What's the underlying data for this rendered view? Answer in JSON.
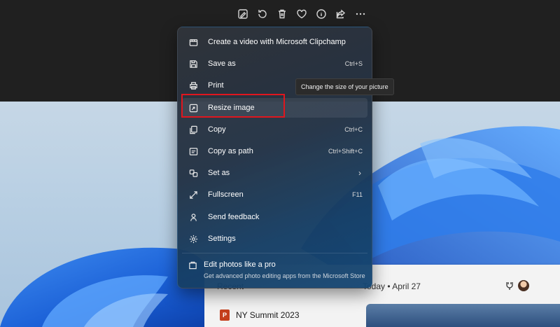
{
  "toolbar": {
    "buttons": [
      {
        "name": "edit-image-icon"
      },
      {
        "name": "rotate-icon"
      },
      {
        "name": "delete-icon"
      },
      {
        "name": "favorite-icon"
      },
      {
        "name": "info-icon"
      },
      {
        "name": "share-icon"
      },
      {
        "name": "more-icon"
      }
    ]
  },
  "menu": {
    "items": [
      {
        "label": "Create a video with Microsoft Clipchamp",
        "shortcut": "",
        "icon": "clipchamp-icon"
      },
      {
        "label": "Save as",
        "shortcut": "Ctrl+S",
        "icon": "save-icon"
      },
      {
        "label": "Print",
        "shortcut": "",
        "icon": "print-icon"
      },
      {
        "label": "Resize image",
        "shortcut": "",
        "icon": "resize-icon"
      },
      {
        "label": "Copy",
        "shortcut": "Ctrl+C",
        "icon": "copy-icon"
      },
      {
        "label": "Copy as path",
        "shortcut": "Ctrl+Shift+C",
        "icon": "copy-path-icon"
      },
      {
        "label": "Set as",
        "shortcut": "",
        "icon": "set-as-icon",
        "has_submenu": true
      },
      {
        "label": "Fullscreen",
        "shortcut": "F11",
        "icon": "fullscreen-icon"
      },
      {
        "label": "Send feedback",
        "shortcut": "",
        "icon": "feedback-icon"
      },
      {
        "label": "Settings",
        "shortcut": "",
        "icon": "settings-icon"
      }
    ],
    "pro": {
      "title": "Edit photos like a pro",
      "subtitle": "Get advanced photo editing apps from the Microsoft Store",
      "icon": "store-icon"
    },
    "submenu_glyph": "›"
  },
  "tooltip": {
    "text": "Change the size of your picture"
  },
  "recent": {
    "title": "Recent",
    "today": "Today • April 27",
    "file_name": "NY Summit 2023",
    "file_icon_letter": "P"
  },
  "colors": {
    "highlight": "#e0161e",
    "menu_bg": "#2a3340",
    "accent": "#1a73e8"
  }
}
